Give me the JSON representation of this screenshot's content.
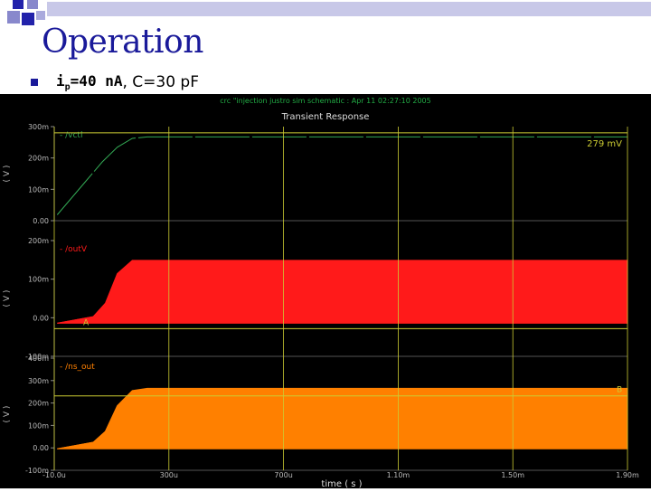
{
  "slide": {
    "title": "Operation",
    "bullet": {
      "i_label": "i",
      "i_sub": "p",
      "i_value": "=40 nA",
      "rest": ", C=30 pF"
    }
  },
  "plot_header": {
    "info": "crc \"injection justro sim schematic : Apr 11 02:27:10 2005",
    "title": "Transient Response",
    "xlabel": "time ( s )",
    "x_ticks": [
      "-10.0u",
      "300u",
      "700u",
      "1.10m",
      "1.50m",
      "1.90m"
    ],
    "marker_label": "279 mV"
  },
  "chart_data": [
    {
      "type": "line",
      "series": [
        {
          "name": "/vctl",
          "color": "#33aa55",
          "x": [
            0.0,
            5e-05,
            0.0001,
            0.00015,
            0.0002,
            0.00025,
            0.0003,
            0.0004,
            0.0008,
            0.0012,
            0.0016,
            0.0019
          ],
          "y": [
            0.0,
            0.06,
            0.12,
            0.18,
            0.23,
            0.26,
            0.265,
            0.265,
            0.265,
            0.265,
            0.265,
            0.265
          ]
        }
      ],
      "x_range": [
        -1e-05,
        0.0019
      ],
      "ylabel": "( V )",
      "yticks": [
        "300m",
        "200m",
        "100m",
        "0.00"
      ],
      "ylim": [
        -0.02,
        0.3
      ],
      "marker_y": 0.279
    },
    {
      "type": "area",
      "series": [
        {
          "name": "/outV",
          "color": "#ff1a1a",
          "band_low": -0.0,
          "band_high": 0.19,
          "x": [
            0.0,
            0.00012,
            0.00016,
            0.0002,
            0.00025,
            0.0003,
            0.0019
          ],
          "y": [
            0.0,
            0.02,
            0.06,
            0.15,
            0.19,
            0.19,
            0.19
          ]
        }
      ],
      "x_range": [
        -1e-05,
        0.0019
      ],
      "ylabel": "( V )",
      "yticks": [
        "200m",
        "100m",
        "0.00",
        "-100m"
      ],
      "ylim": [
        -0.1,
        0.25
      ],
      "marker_label": "A"
    },
    {
      "type": "area",
      "series": [
        {
          "name": "/ns_out",
          "color": "#ff8000",
          "band_low": -0.0,
          "band_high": 0.28,
          "x": [
            0.0,
            0.00012,
            0.00016,
            0.0002,
            0.00025,
            0.0003,
            0.0019
          ],
          "y": [
            0.0,
            0.03,
            0.08,
            0.2,
            0.27,
            0.28,
            0.28
          ]
        }
      ],
      "x_range": [
        -1e-05,
        0.0019
      ],
      "ylabel": "( V )",
      "yticks": [
        "400m",
        "300m",
        "200m",
        "100m",
        "0.00",
        "-100m"
      ],
      "ylim": [
        -0.1,
        0.42
      ],
      "marker_y": 0.245,
      "marker_label": "B"
    }
  ]
}
